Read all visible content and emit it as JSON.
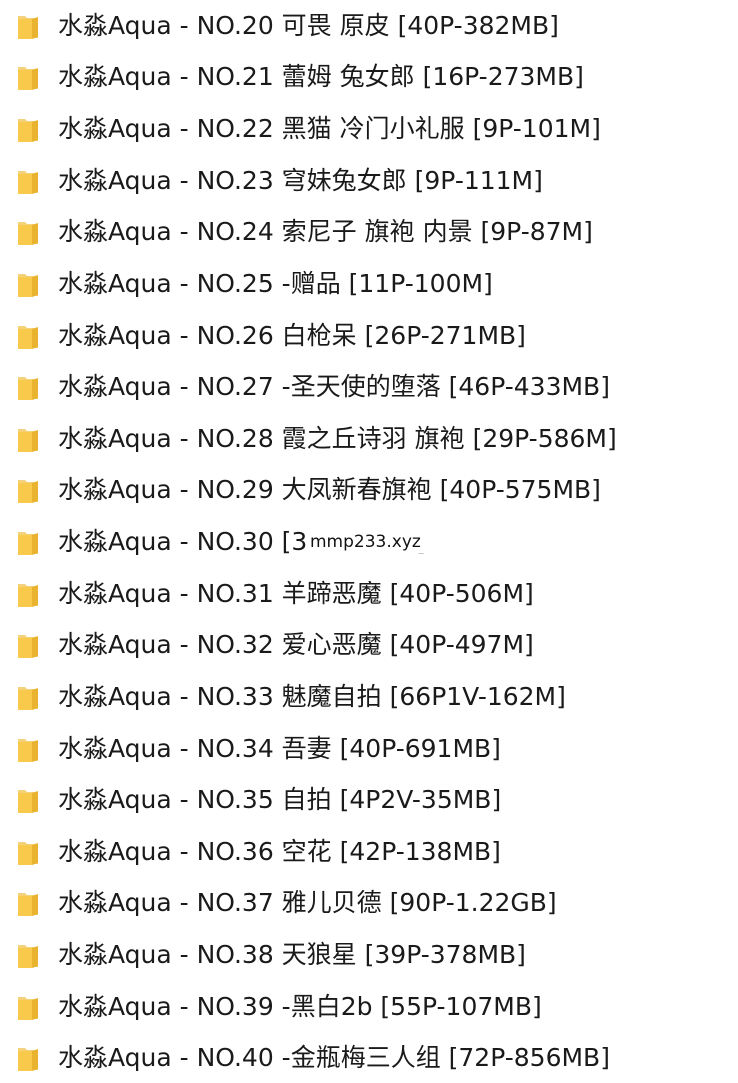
{
  "colors": {
    "folder_front": "#f8c94a",
    "folder_back": "#f4d27a",
    "folder_edge": "#eab32f",
    "text": "#1a1a1a",
    "background": "#ffffff"
  },
  "icon": "folder-icon",
  "folders": [
    {
      "name": "水淼Aqua - NO.20 可畏 原皮 [40P-382MB]"
    },
    {
      "name": "水淼Aqua - NO.21 蕾姆 兔女郎 [16P-273MB]"
    },
    {
      "name": "水淼Aqua - NO.22 黑猫 冷门小礼服 [9P-101M]"
    },
    {
      "name": "水淼Aqua - NO.23 穹妹兔女郎 [9P-111M]"
    },
    {
      "name": "水淼Aqua - NO.24 索尼子 旗袍 内景 [9P-87M]"
    },
    {
      "name": "水淼Aqua - NO.25 -赠品 [11P-100M]"
    },
    {
      "name": "水淼Aqua - NO.26 白枪呆 [26P-271MB]"
    },
    {
      "name": "水淼Aqua - NO.27 -圣天使的堕落 [46P-433MB]"
    },
    {
      "name": "水淼Aqua - NO.28 霞之丘诗羽 旗袍 [29P-586M]"
    },
    {
      "name": "水淼Aqua - NO.29 大凤新春旗袍 [40P-575MB]"
    },
    {
      "name": "水淼Aqua - NO.30                  [31P-393M]"
    },
    {
      "name": "水淼Aqua - NO.31 羊蹄恶魔 [40P-506M]"
    },
    {
      "name": "水淼Aqua - NO.32 爱心恶魔 [40P-497M]"
    },
    {
      "name": "水淼Aqua - NO.33 魅魔自拍 [66P1V-162M]"
    },
    {
      "name": "水淼Aqua - NO.34 吾妻 [40P-691MB]"
    },
    {
      "name": "水淼Aqua - NO.35 自拍 [4P2V-35MB]"
    },
    {
      "name": "水淼Aqua - NO.36 空花 [42P-138MB]"
    },
    {
      "name": "水淼Aqua - NO.37 雅儿贝德 [90P-1.22GB]"
    },
    {
      "name": "水淼Aqua - NO.38 天狼星 [39P-378MB]"
    },
    {
      "name": "水淼Aqua - NO.39 -黑白2b [55P-107MB]"
    },
    {
      "name": "水淼Aqua - NO.40 -金瓶梅三人组 [72P-856MB]"
    }
  ],
  "watermark": "mmp233.xyz"
}
